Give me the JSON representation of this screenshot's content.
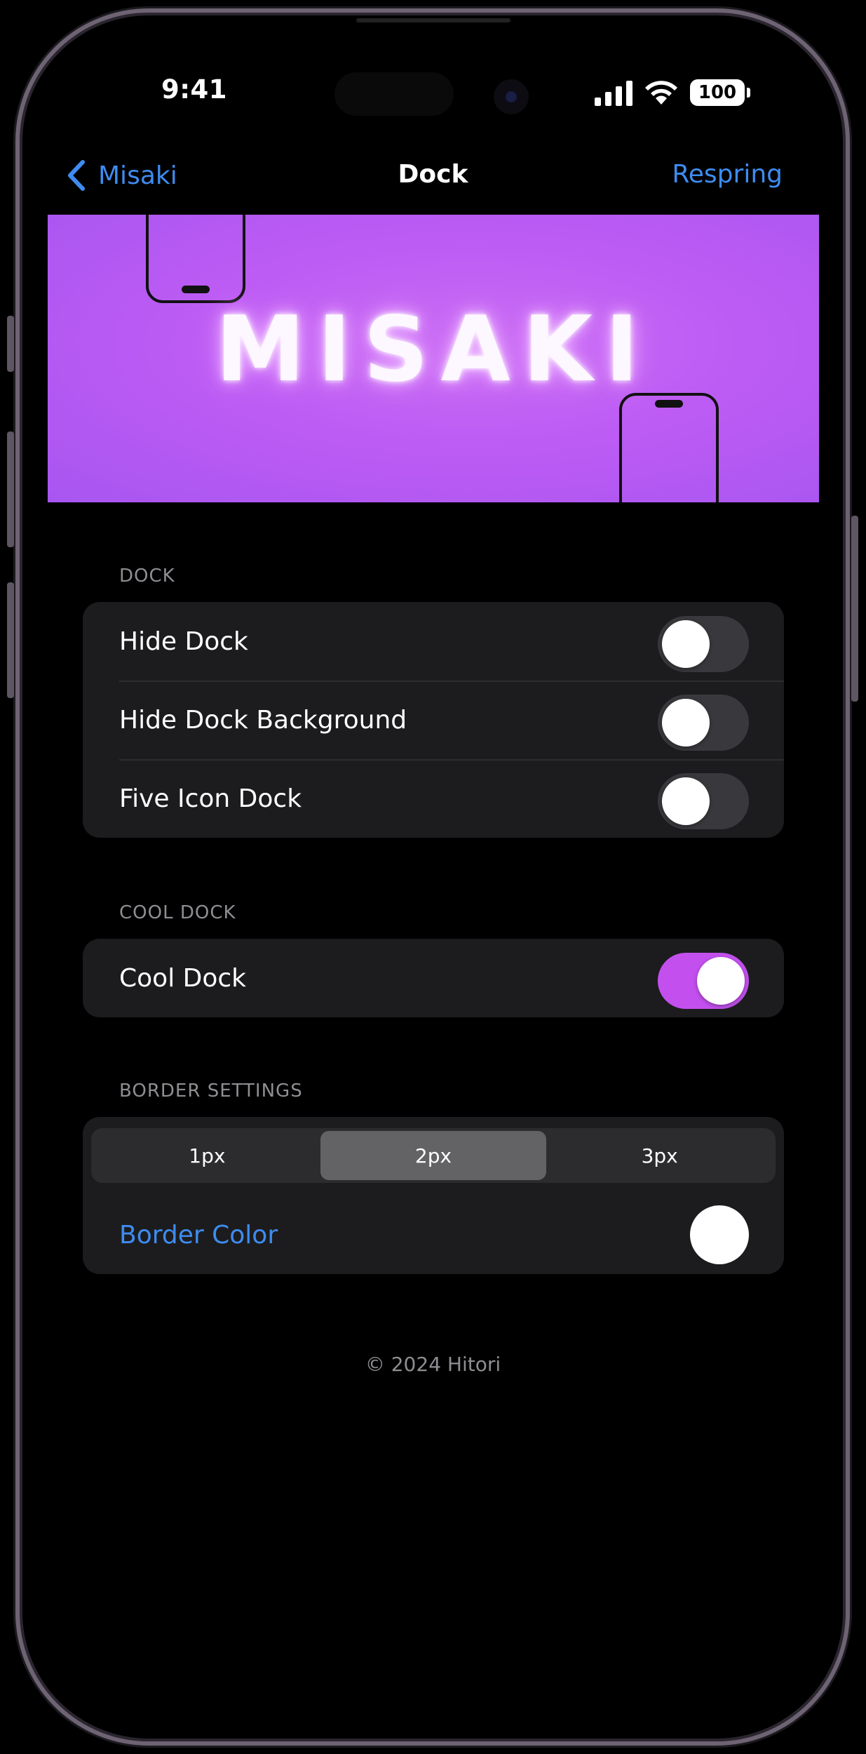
{
  "status_bar": {
    "time": "9:41",
    "battery": "100"
  },
  "nav": {
    "back_label": "Misaki",
    "title": "Dock",
    "action_label": "Respring",
    "accent_color": "#3e8cf0"
  },
  "banner": {
    "word": "MISAKI",
    "background_color": "#bd5cf4"
  },
  "sections": {
    "dock": {
      "header": "DOCK",
      "rows": [
        {
          "label": "Hide Dock",
          "on": false
        },
        {
          "label": "Hide Dock Background",
          "on": false
        },
        {
          "label": "Five Icon Dock",
          "on": false
        }
      ]
    },
    "cool_dock": {
      "header": "COOL DOCK",
      "rows": [
        {
          "label": "Cool Dock",
          "on": true
        }
      ]
    },
    "border_settings": {
      "header": "BORDER SETTINGS",
      "segments": [
        "1px",
        "2px",
        "3px"
      ],
      "selected_segment": "2px",
      "border_color_label": "Border Color",
      "border_color_value": "#ffffff"
    }
  },
  "toggle_on_color": "#c350ee",
  "footer": "© 2024 Hitori"
}
